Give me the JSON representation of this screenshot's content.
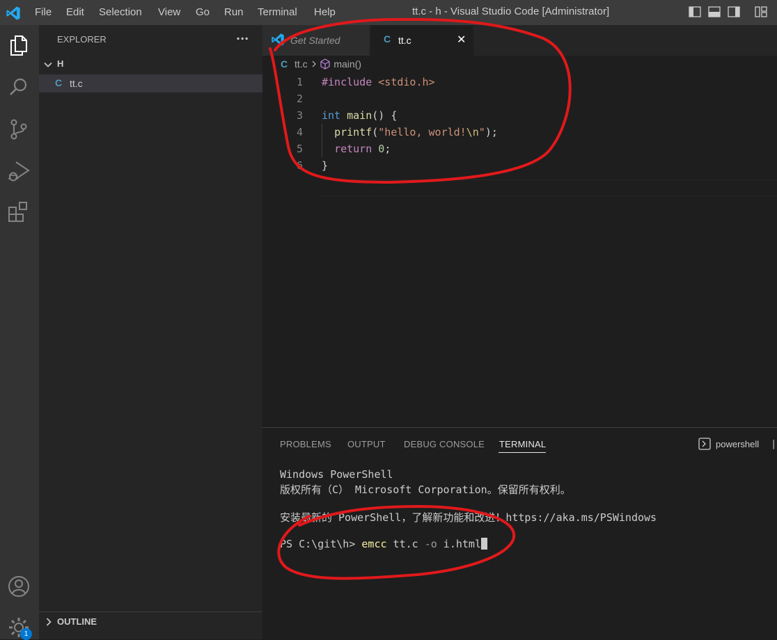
{
  "titlebar": {
    "menu": [
      "File",
      "Edit",
      "Selection",
      "View",
      "Go",
      "Run",
      "Terminal",
      "Help"
    ],
    "window_title": "tt.c - h - Visual Studio Code [Administrator]"
  },
  "activitybar": {
    "icons": [
      "files-icon",
      "search-icon",
      "source-control-icon",
      "run-debug-icon",
      "extensions-icon",
      "account-icon",
      "settings-gear-icon"
    ],
    "settings_badge": "1"
  },
  "sidebar": {
    "header": "EXPLORER",
    "more": "···",
    "folder": "H",
    "file_icon": "C",
    "file": "tt.c",
    "outline": "OUTLINE"
  },
  "tabs": {
    "get_started": "Get Started",
    "file_icon": "C",
    "active": "tt.c",
    "close": "✕"
  },
  "breadcrumb": {
    "icon": "C",
    "file": "tt.c",
    "symbol": "main()"
  },
  "editor": {
    "line_numbers": [
      "1",
      "2",
      "3",
      "4",
      "5",
      "6"
    ],
    "lines": [
      [
        {
          "t": "#include",
          "c": "#c586c0"
        },
        {
          "t": " ",
          "c": "#d4d4d4"
        },
        {
          "t": "<stdio.h>",
          "c": "#ce9178"
        }
      ],
      [],
      [
        {
          "t": "int",
          "c": "#569cd6"
        },
        {
          "t": " ",
          "c": "#d4d4d4"
        },
        {
          "t": "main",
          "c": "#dcdcaa"
        },
        {
          "t": "() {",
          "c": "#d4d4d4"
        }
      ],
      [
        {
          "t": "  ",
          "c": "#d4d4d4"
        },
        {
          "t": "printf",
          "c": "#dcdcaa"
        },
        {
          "t": "(",
          "c": "#d4d4d4"
        },
        {
          "t": "\"hello, world!",
          "c": "#ce9178"
        },
        {
          "t": "\\n",
          "c": "#d7ba7d"
        },
        {
          "t": "\"",
          "c": "#ce9178"
        },
        {
          "t": ");",
          "c": "#d4d4d4"
        }
      ],
      [
        {
          "t": "  ",
          "c": "#d4d4d4"
        },
        {
          "t": "return",
          "c": "#c586c0"
        },
        {
          "t": " ",
          "c": "#d4d4d4"
        },
        {
          "t": "0",
          "c": "#b5cea8"
        },
        {
          "t": ";",
          "c": "#d4d4d4"
        }
      ],
      [
        {
          "t": "}",
          "c": "#d4d4d4"
        }
      ]
    ]
  },
  "panel": {
    "tabs": [
      "PROBLEMS",
      "OUTPUT",
      "DEBUG CONSOLE",
      "TERMINAL"
    ],
    "active_tab": "TERMINAL",
    "shell": "powershell",
    "terminal": {
      "line1": "Windows PowerShell",
      "line2": "版权所有（C） Microsoft Corporation。保留所有权利。",
      "line3": "安装最新的 PowerShell，了解新功能和改进！https://aka.ms/PSWindows",
      "prompt": "PS C:\\git\\h> ",
      "cmd": "emcc",
      "arg1": " tt.c ",
      "flag": "-o",
      "arg2": " i.html"
    }
  },
  "colors": {
    "accent_blue": "#0078d4",
    "vscode_logo": "#23a9f2",
    "c_file_icon": "#519aba",
    "annotation_red": "#e0191b"
  }
}
